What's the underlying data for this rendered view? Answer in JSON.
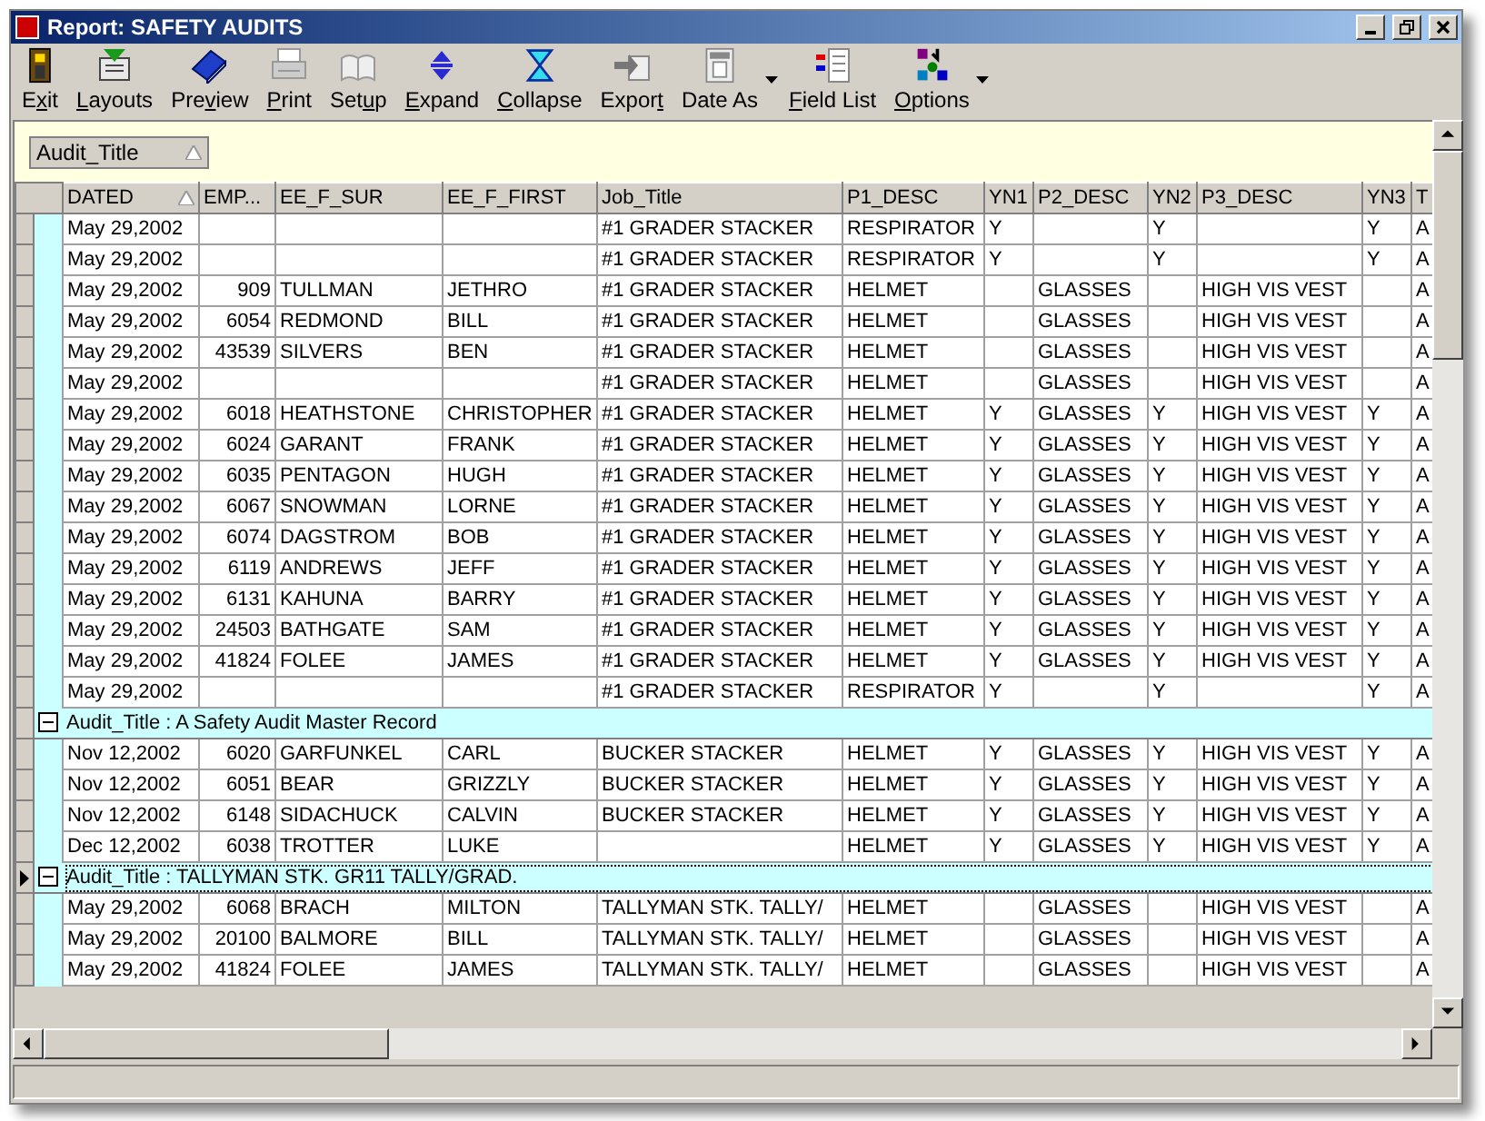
{
  "window": {
    "title": "Report: SAFETY AUDITS"
  },
  "toolbar": [
    {
      "pre": "E",
      "key": "x",
      "post": "it",
      "dropdown": false
    },
    {
      "key": "L",
      "post": "ayouts",
      "dropdown": false
    },
    {
      "pre": "Pre",
      "key": "v",
      "post": "iew",
      "dropdown": false
    },
    {
      "key": "P",
      "post": "rint",
      "dropdown": false
    },
    {
      "pre": "Set",
      "key": "u",
      "post": "p",
      "dropdown": false
    },
    {
      "key": "E",
      "post": "xpand",
      "dropdown": false
    },
    {
      "key": "C",
      "post": "ollapse",
      "dropdown": false
    },
    {
      "pre": "Expor",
      "key": "t",
      "dropdown": false
    },
    {
      "pre": "Date As",
      "dropdown": true
    },
    {
      "key": "F",
      "post": "ield List",
      "dropdown": false
    },
    {
      "key": "O",
      "post": "ptions",
      "dropdown": true
    }
  ],
  "group_panel": {
    "fields": [
      {
        "label": "Audit_Title",
        "sorted": true
      }
    ]
  },
  "table": {
    "columns": [
      {
        "label": "DATED",
        "sorted": true
      },
      {
        "label": "EMP...",
        "sorted": false
      },
      {
        "label": "EE_F_SUR",
        "sorted": false
      },
      {
        "label": "EE_F_FIRST",
        "sorted": false
      },
      {
        "label": "Job_Title",
        "sorted": false
      },
      {
        "label": "P1_DESC",
        "sorted": false
      },
      {
        "label": "YN1",
        "sorted": false
      },
      {
        "label": "P2_DESC",
        "sorted": false
      },
      {
        "label": "YN2",
        "sorted": false
      },
      {
        "label": "P3_DESC",
        "sorted": false
      },
      {
        "label": "YN3",
        "sorted": false
      },
      {
        "label": "T",
        "sorted": false
      }
    ],
    "rows": [
      {
        "kind": "record",
        "current": false,
        "cells": [
          "May 29,2002",
          null,
          null,
          null,
          "#1 GRADER STACKER",
          "RESPIRATOR",
          "Y",
          null,
          "Y",
          null,
          "Y",
          "A"
        ]
      },
      {
        "kind": "record",
        "current": false,
        "cells": [
          "May 29,2002",
          null,
          null,
          null,
          "#1 GRADER STACKER",
          "RESPIRATOR",
          "Y",
          null,
          "Y",
          null,
          "Y",
          "A"
        ]
      },
      {
        "kind": "record",
        "current": false,
        "cells": [
          "May 29,2002",
          "909",
          "TULLMAN",
          "JETHRO",
          "#1 GRADER STACKER",
          "HELMET",
          null,
          "GLASSES",
          null,
          "HIGH VIS VEST",
          null,
          "A"
        ]
      },
      {
        "kind": "record",
        "current": false,
        "cells": [
          "May 29,2002",
          "6054",
          "REDMOND",
          "BILL",
          "#1 GRADER STACKER",
          "HELMET",
          null,
          "GLASSES",
          null,
          "HIGH VIS VEST",
          null,
          "A"
        ]
      },
      {
        "kind": "record",
        "current": false,
        "cells": [
          "May 29,2002",
          "43539",
          "SILVERS",
          "BEN",
          "#1 GRADER STACKER",
          "HELMET",
          null,
          "GLASSES",
          null,
          "HIGH VIS VEST",
          null,
          "A"
        ]
      },
      {
        "kind": "record",
        "current": false,
        "cells": [
          "May 29,2002",
          null,
          null,
          null,
          "#1 GRADER STACKER",
          "HELMET",
          null,
          "GLASSES",
          null,
          "HIGH VIS VEST",
          null,
          "A"
        ]
      },
      {
        "kind": "record",
        "current": false,
        "cells": [
          "May 29,2002",
          "6018",
          "HEATHSTONE",
          "CHRISTOPHER",
          "#1 GRADER STACKER",
          "HELMET",
          "Y",
          "GLASSES",
          "Y",
          "HIGH VIS VEST",
          "Y",
          "A"
        ]
      },
      {
        "kind": "record",
        "current": false,
        "cells": [
          "May 29,2002",
          "6024",
          "GARANT",
          "FRANK",
          "#1 GRADER STACKER",
          "HELMET",
          "Y",
          "GLASSES",
          "Y",
          "HIGH VIS VEST",
          "Y",
          "A"
        ]
      },
      {
        "kind": "record",
        "current": false,
        "cells": [
          "May 29,2002",
          "6035",
          "PENTAGON",
          "HUGH",
          "#1 GRADER STACKER",
          "HELMET",
          "Y",
          "GLASSES",
          "Y",
          "HIGH VIS VEST",
          "Y",
          "A"
        ]
      },
      {
        "kind": "record",
        "current": false,
        "cells": [
          "May 29,2002",
          "6067",
          "SNOWMAN",
          "LORNE",
          "#1 GRADER STACKER",
          "HELMET",
          "Y",
          "GLASSES",
          "Y",
          "HIGH VIS VEST",
          "Y",
          "A"
        ]
      },
      {
        "kind": "record",
        "current": false,
        "cells": [
          "May 29,2002",
          "6074",
          "DAGSTROM",
          "BOB",
          "#1 GRADER STACKER",
          "HELMET",
          "Y",
          "GLASSES",
          "Y",
          "HIGH VIS VEST",
          "Y",
          "A"
        ]
      },
      {
        "kind": "record",
        "current": false,
        "cells": [
          "May 29,2002",
          "6119",
          "ANDREWS",
          "JEFF",
          "#1 GRADER STACKER",
          "HELMET",
          "Y",
          "GLASSES",
          "Y",
          "HIGH VIS VEST",
          "Y",
          "A"
        ]
      },
      {
        "kind": "record",
        "current": false,
        "cells": [
          "May 29,2002",
          "6131",
          "KAHUNA",
          "BARRY",
          "#1 GRADER STACKER",
          "HELMET",
          "Y",
          "GLASSES",
          "Y",
          "HIGH VIS VEST",
          "Y",
          "A"
        ]
      },
      {
        "kind": "record",
        "current": false,
        "cells": [
          "May 29,2002",
          "24503",
          "BATHGATE",
          "SAM",
          "#1 GRADER STACKER",
          "HELMET",
          "Y",
          "GLASSES",
          "Y",
          "HIGH VIS VEST",
          "Y",
          "A"
        ]
      },
      {
        "kind": "record",
        "current": false,
        "cells": [
          "May 29,2002",
          "41824",
          "FOLEE",
          "JAMES",
          "#1 GRADER STACKER",
          "HELMET",
          "Y",
          "GLASSES",
          "Y",
          "HIGH VIS VEST",
          "Y",
          "A"
        ]
      },
      {
        "kind": "record",
        "current": false,
        "cells": [
          "May 29,2002",
          null,
          null,
          null,
          "#1 GRADER STACKER",
          "RESPIRATOR",
          "Y",
          null,
          "Y",
          null,
          "Y",
          "A"
        ]
      },
      {
        "kind": "group",
        "current": false,
        "expanded": true,
        "text": "Audit_Title : A Safety Audit Master Record"
      },
      {
        "kind": "record",
        "current": false,
        "cells": [
          "Nov 12,2002",
          "6020",
          "GARFUNKEL",
          "CARL",
          "BUCKER STACKER",
          "HELMET",
          "Y",
          "GLASSES",
          "Y",
          "HIGH VIS VEST",
          "Y",
          "A"
        ]
      },
      {
        "kind": "record",
        "current": false,
        "cells": [
          "Nov 12,2002",
          "6051",
          "BEAR",
          "GRIZZLY",
          "BUCKER STACKER",
          "HELMET",
          "Y",
          "GLASSES",
          "Y",
          "HIGH VIS VEST",
          "Y",
          "A"
        ]
      },
      {
        "kind": "record",
        "current": false,
        "cells": [
          "Nov 12,2002",
          "6148",
          "SIDACHUCK",
          "CALVIN",
          "BUCKER STACKER",
          "HELMET",
          "Y",
          "GLASSES",
          "Y",
          "HIGH VIS VEST",
          "Y",
          "A"
        ]
      },
      {
        "kind": "record",
        "current": false,
        "cells": [
          "Dec 12,2002",
          "6038",
          "TROTTER",
          "LUKE",
          null,
          "HELMET",
          "Y",
          "GLASSES",
          "Y",
          "HIGH VIS VEST",
          "Y",
          "A"
        ]
      },
      {
        "kind": "group",
        "current": true,
        "expanded": true,
        "text": "Audit_Title : TALLYMAN STK. GR11 TALLY/GRAD."
      },
      {
        "kind": "record",
        "current": false,
        "cells": [
          "May 29,2002",
          "6068",
          "BRACH",
          "MILTON",
          "TALLYMAN STK. TALLY/",
          "HELMET",
          null,
          "GLASSES",
          null,
          "HIGH VIS VEST",
          null,
          "A"
        ]
      },
      {
        "kind": "record",
        "current": false,
        "cells": [
          "May 29,2002",
          "20100",
          "BALMORE",
          "BILL",
          "TALLYMAN STK. TALLY/",
          "HELMET",
          null,
          "GLASSES",
          null,
          "HIGH VIS VEST",
          null,
          "A"
        ]
      },
      {
        "kind": "record",
        "current": false,
        "cells": [
          "May 29,2002",
          "41824",
          "FOLEE",
          "JAMES",
          "TALLYMAN STK. TALLY/",
          "HELMET",
          null,
          "GLASSES",
          null,
          "HIGH VIS VEST",
          null,
          "A"
        ]
      }
    ]
  }
}
